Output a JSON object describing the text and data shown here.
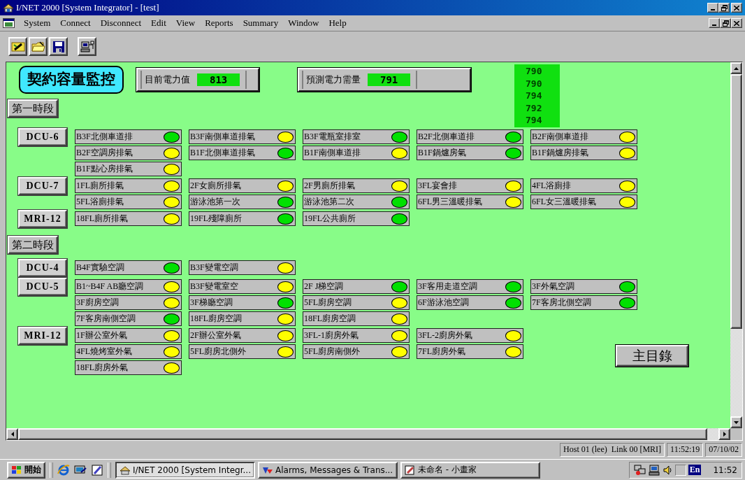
{
  "window": {
    "title": "I/NET 2000 [System Integrator] - [test]"
  },
  "menu": [
    "System",
    "Connect",
    "Disconnect",
    "Edit",
    "View",
    "Reports",
    "Summary",
    "Window",
    "Help"
  ],
  "panel": {
    "title": "契約容量監控",
    "current": {
      "label": "目前電力值",
      "value": "813"
    },
    "forecast": {
      "label": "預測電力需量",
      "value": "791"
    },
    "readings": [
      "790",
      "790",
      "794",
      "792",
      "794"
    ],
    "sections": [
      {
        "label": "第一時段",
        "groups": [
          {
            "unit": "DCU-6",
            "rows": [
              [
                {
                  "label": "B3F北側車道排",
                  "on": true
                },
                {
                  "label": "B3F南側車道排氣",
                  "on": false
                },
                {
                  "label": "B3F電瓶室排室",
                  "on": true
                },
                {
                  "label": "B2F北側車道排",
                  "on": true
                },
                {
                  "label": "B2F南側車道排",
                  "on": false
                }
              ],
              [
                {
                  "label": "B2F空調房排氣",
                  "on": false
                },
                {
                  "label": "B1F北側車道排氣",
                  "on": true
                },
                {
                  "label": "B1F南側車道排",
                  "on": false
                },
                {
                  "label": "B1F鍋爐房氣",
                  "on": true
                },
                {
                  "label": "B1F鍋爐房排氣",
                  "on": false
                }
              ],
              [
                {
                  "label": "B1F點心房排氣",
                  "on": false
                }
              ]
            ]
          },
          {
            "unit": "DCU-7",
            "rows": [
              [
                {
                  "label": "1FL廁所排氣",
                  "on": false
                },
                {
                  "label": "2F女廁所排氣",
                  "on": false
                },
                {
                  "label": "2F男廁所排氣",
                  "on": false
                },
                {
                  "label": "3FL宴會排",
                  "on": false
                },
                {
                  "label": "4FL浴廁排",
                  "on": false
                }
              ],
              [
                {
                  "label": "5FL浴廁排氣",
                  "on": false
                },
                {
                  "label": "游泳池第一次",
                  "on": true
                },
                {
                  "label": "游泳池第二次",
                  "on": true
                },
                {
                  "label": "6FL男三溫暖排氣",
                  "on": false
                },
                {
                  "label": "6FL女三溫暖排氣",
                  "on": false
                }
              ]
            ]
          },
          {
            "unit": "MRI-12",
            "rows": [
              [
                {
                  "label": "18FL廁所排氣",
                  "on": false
                },
                {
                  "label": "19FL殘障廁所",
                  "on": true
                },
                {
                  "label": "19FL公共廁所",
                  "on": true
                }
              ]
            ]
          }
        ]
      },
      {
        "label": "第二時段",
        "groups": [
          {
            "unit": "DCU-4",
            "rows": [
              [
                {
                  "label": "B4F實驗空調",
                  "on": true
                },
                {
                  "label": "B3F變電空調",
                  "on": false
                }
              ]
            ]
          },
          {
            "unit": "DCU-5",
            "rows": [
              [
                {
                  "label": "B1~B4F AB廳空調",
                  "on": false
                },
                {
                  "label": "B3F變電室空",
                  "on": false
                },
                {
                  "label": "2F J梯空調",
                  "on": true
                },
                {
                  "label": "3F客用走道空調",
                  "on": true
                },
                {
                  "label": "3F外氣空調",
                  "on": true
                }
              ],
              [
                {
                  "label": "3F廚房空調",
                  "on": false
                },
                {
                  "label": "3F梯廳空調",
                  "on": true
                },
                {
                  "label": "5FL廚房空調",
                  "on": false
                },
                {
                  "label": "6F游泳池空調",
                  "on": true
                },
                {
                  "label": "7F客房北側空調",
                  "on": true
                }
              ],
              [
                {
                  "label": "7F客房南側空調",
                  "on": true
                },
                {
                  "label": "18FL廚房空調",
                  "on": false
                },
                {
                  "label": "18FL廚房空調",
                  "on": false
                }
              ]
            ]
          },
          {
            "unit": "MRI-12",
            "rows": [
              [
                {
                  "label": "1F辦公室外氣",
                  "on": false
                },
                {
                  "label": "2F辦公室外氣",
                  "on": false
                },
                {
                  "label": "3FL-1廚房外氣",
                  "on": false
                },
                {
                  "label": "3FL-2廚房外氣",
                  "on": false
                }
              ],
              [
                {
                  "label": "4FL燒烤室外氣",
                  "on": false
                },
                {
                  "label": "5FL廚房北側外",
                  "on": false
                },
                {
                  "label": "5FL廚房南側外",
                  "on": false
                },
                {
                  "label": "7FL廚房外氣",
                  "on": false
                }
              ],
              [
                {
                  "label": "18FL廚房外氣",
                  "on": false
                }
              ]
            ]
          }
        ]
      }
    ],
    "main_menu_button": "主目錄"
  },
  "status_bar": [
    "Host 01 (lee)  Link 00 [MRI]",
    "11:52:19",
    "07/10/02"
  ],
  "taskbar": {
    "start": "開始",
    "tasks": [
      {
        "label": "I/NET 2000 [System Integr...",
        "selected": true
      },
      {
        "label": "Alarms, Messages & Trans...",
        "selected": false
      },
      {
        "label": "未命名 - 小畫家",
        "selected": false
      }
    ],
    "ime": "En",
    "clock": "11:52"
  }
}
